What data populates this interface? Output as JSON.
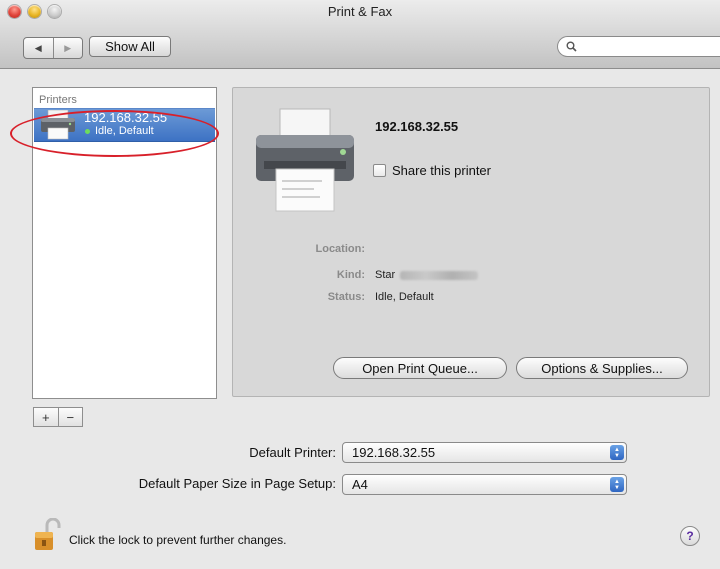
{
  "window": {
    "title": "Print & Fax"
  },
  "toolbar": {
    "back_glyph": "◀",
    "forward_glyph": "▶",
    "show_all": "Show All",
    "search": {
      "placeholder": "",
      "icon": "search-icon"
    }
  },
  "printers": {
    "header": "Printers",
    "items": [
      {
        "name": "192.168.32.55",
        "status": "Idle, Default",
        "selected": true,
        "status_color": "#6edc5d"
      }
    ]
  },
  "list_controls": {
    "add": "+",
    "remove": "−"
  },
  "detail": {
    "name": "192.168.32.55",
    "share_label": "Share this printer",
    "share_checked": false,
    "location_label": "Location:",
    "location_value": "",
    "kind_label": "Kind:",
    "kind_value": "Star",
    "status_label": "Status:",
    "status_value": "Idle, Default",
    "open_queue": "Open Print Queue...",
    "options_supplies": "Options & Supplies..."
  },
  "defaults": {
    "printer_label": "Default Printer:",
    "printer_value": "192.168.32.55",
    "paper_label": "Default Paper Size in Page Setup:",
    "paper_value": "A4"
  },
  "footer": {
    "lock_text": "Click the lock to prevent further changes.",
    "help_glyph": "?"
  },
  "colors": {
    "selection": "#3d72c4",
    "annotation_ring": "#d8202a"
  }
}
